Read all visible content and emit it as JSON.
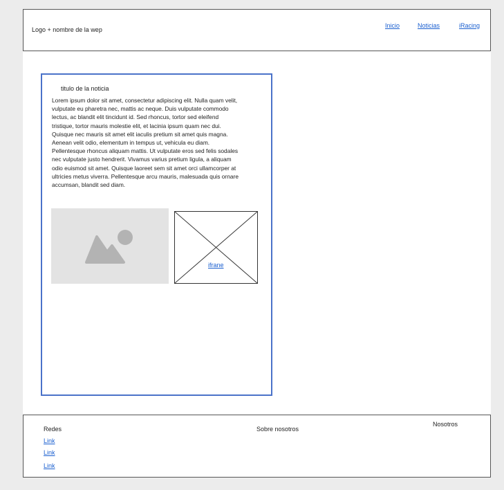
{
  "header": {
    "logo_text": "Logo + nombre de la wep",
    "nav": [
      "Inicio",
      "Noticias",
      "iRacing"
    ]
  },
  "article": {
    "title": "titulo de la noticia",
    "body": "Lorem ipsum dolor sit amet, consectetur adipiscing elit. Nulla quam velit, vulputate eu pharetra nec, mattis ac neque. Duis vulputate commodo lectus, ac blandit elit tincidunt id. Sed rhoncus, tortor sed eleifend tristique, tortor mauris molestie elit, et lacinia ipsum quam nec dui. Quisque nec mauris sit amet elit iaculis pretium sit amet quis magna. Aenean velit odio, elementum in tempus ut, vehicula eu diam. Pellentesque rhoncus aliquam mattis. Ut vulputate eros sed felis sodales nec vulputate justo hendrerit. Vivamus varius pretium ligula, a aliquam odio euismod sit amet. Quisque laoreet sem sit amet orci ullamcorper at ultricies metus viverra. Pellentesque arcu mauris, malesuada quis ornare accumsan, blandit sed diam.",
    "image_icon": "image-placeholder-icon",
    "iframe_label": "ifrane"
  },
  "footer": {
    "redes_heading": "Redes",
    "links": [
      "Link",
      "Link",
      "Link"
    ],
    "sobre_heading": "Sobre nosotros",
    "nosotros_heading": "Nosotros"
  },
  "colors": {
    "link": "#1a5fd0",
    "article_border": "#4a72c9",
    "background": "#ececec",
    "image_placeholder": "#e3e3e3",
    "image_icon": "#b3b3b3"
  }
}
